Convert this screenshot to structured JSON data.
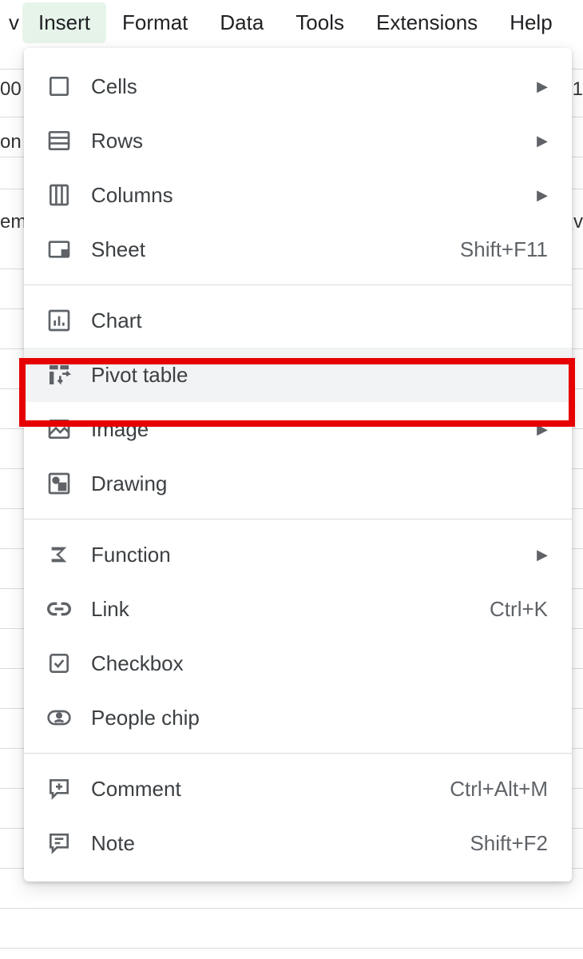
{
  "menubar": {
    "partial_left": "v",
    "items": [
      "Insert",
      "Format",
      "Data",
      "Tools",
      "Extensions",
      "Help"
    ],
    "active_index": 0
  },
  "background": {
    "frag1": "00",
    "frag2": "on",
    "frag3": "em",
    "frag_right1": "1",
    "frag_right2": "v"
  },
  "dropdown": {
    "groups": [
      [
        {
          "icon": "cells",
          "label": "Cells",
          "submenu": true
        },
        {
          "icon": "rows",
          "label": "Rows",
          "submenu": true
        },
        {
          "icon": "columns",
          "label": "Columns",
          "submenu": true
        },
        {
          "icon": "sheet",
          "label": "Sheet",
          "shortcut": "Shift+F11"
        }
      ],
      [
        {
          "icon": "chart",
          "label": "Chart"
        },
        {
          "icon": "pivot",
          "label": "Pivot table",
          "hover": true,
          "highlight": true
        },
        {
          "icon": "image",
          "label": "Image",
          "submenu": true
        },
        {
          "icon": "drawing",
          "label": "Drawing"
        }
      ],
      [
        {
          "icon": "function",
          "label": "Function",
          "submenu": true
        },
        {
          "icon": "link",
          "label": "Link",
          "shortcut": "Ctrl+K"
        },
        {
          "icon": "checkbox",
          "label": "Checkbox"
        },
        {
          "icon": "people",
          "label": "People chip"
        }
      ],
      [
        {
          "icon": "comment",
          "label": "Comment",
          "shortcut": "Ctrl+Alt+M"
        },
        {
          "icon": "note",
          "label": "Note",
          "shortcut": "Shift+F2"
        }
      ]
    ]
  }
}
